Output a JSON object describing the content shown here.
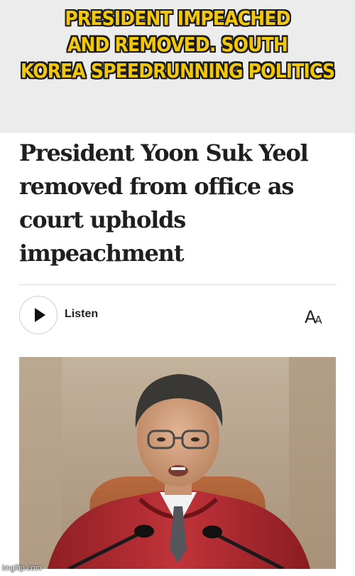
{
  "meme": {
    "caption_lines": [
      "PRESIDENT IMPEACHED",
      "AND REMOVED. SOUTH",
      "KOREA SPEEDRUNNING POLITICS"
    ],
    "caption_color": "#f3c80a"
  },
  "article": {
    "headline_lines": [
      "President Yoon Suk Yeol",
      "removed from office as",
      "court upholds",
      "impeachment"
    ],
    "audio": {
      "play_icon": "play-icon",
      "label": "Listen"
    },
    "text_size": {
      "icon": "text-size-icon",
      "big": "A",
      "small": "A"
    },
    "photo": {
      "subject": "judge in red robe speaking at microphones"
    }
  },
  "watermark": "imgflip.com"
}
